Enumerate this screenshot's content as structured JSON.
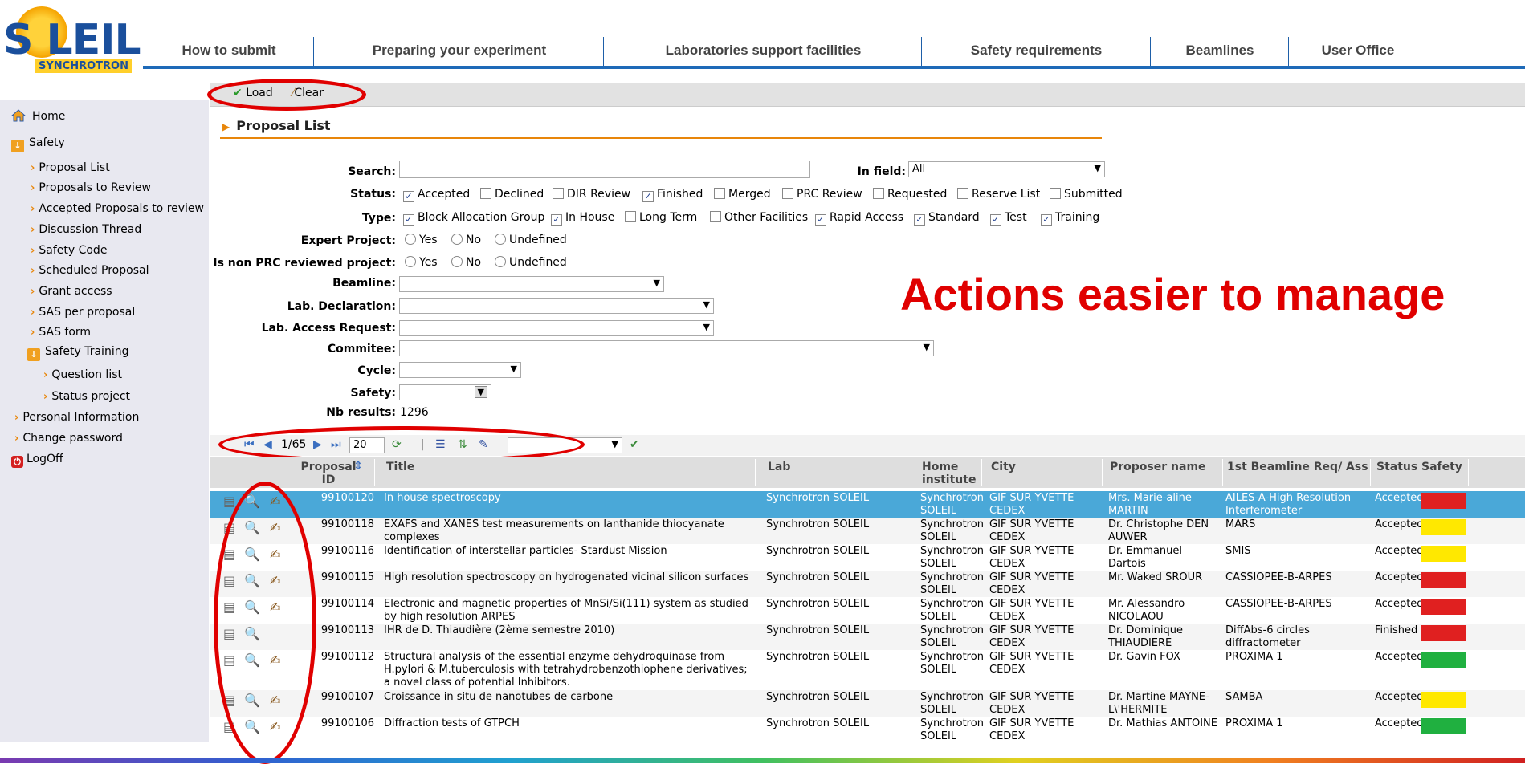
{
  "logo": {
    "word": "S LEIL",
    "sub": "SYNCHROTRON"
  },
  "nav": [
    "How to submit",
    "Preparing your experiment",
    "Laboratories support facilities",
    "Safety requirements",
    "Beamlines",
    "User Office"
  ],
  "sidebar": {
    "home": "Home",
    "safety": "Safety",
    "items": [
      "Proposal List",
      "Proposals to Review",
      "Accepted Proposals to review",
      "Discussion Thread",
      "Safety Code",
      "Scheduled Proposal",
      "Grant access",
      "SAS per proposal",
      "SAS form"
    ],
    "training": "Safety Training",
    "training_items": [
      "Question list",
      "Status project"
    ],
    "personal": "Personal Information",
    "password": "Change password",
    "logoff": "LogOff"
  },
  "toolbar": {
    "load": "Load",
    "clear": "Clear"
  },
  "panel_title": "Proposal List",
  "form": {
    "search_label": "Search:",
    "infield_label": "In field:",
    "infield_value": "All",
    "status_label": "Status:",
    "status_options": [
      {
        "label": "Accepted",
        "checked": true
      },
      {
        "label": "Declined",
        "checked": false
      },
      {
        "label": "DIR Review",
        "checked": false
      },
      {
        "label": "Finished",
        "checked": true
      },
      {
        "label": "Merged",
        "checked": false
      },
      {
        "label": "PRC Review",
        "checked": false
      },
      {
        "label": "Requested",
        "checked": false
      },
      {
        "label": "Reserve List",
        "checked": false
      },
      {
        "label": "Submitted",
        "checked": false
      }
    ],
    "type_label": "Type:",
    "type_options": [
      {
        "label": "Block Allocation Group",
        "checked": true
      },
      {
        "label": "In House",
        "checked": true
      },
      {
        "label": "Long Term",
        "checked": false
      },
      {
        "label": "Other Facilities",
        "checked": false
      },
      {
        "label": "Rapid Access",
        "checked": true
      },
      {
        "label": "Standard",
        "checked": true
      },
      {
        "label": "Test",
        "checked": true
      },
      {
        "label": "Training",
        "checked": true
      }
    ],
    "expert_label": "Expert Project:",
    "nonprc_label": "Is non PRC reviewed project:",
    "radio_options": [
      "Yes",
      "No",
      "Undefined"
    ],
    "beamline_label": "Beamline:",
    "labdecl_label": "Lab. Declaration:",
    "labaccess_label": "Lab. Access Request:",
    "commitee_label": "Commitee:",
    "cycle_label": "Cycle:",
    "safety_label": "Safety:",
    "nbresults_label": "Nb results:",
    "nbresults_value": "1296"
  },
  "annotation": "Actions easier to manage",
  "pager": {
    "page": "1/65",
    "page_size": "20"
  },
  "table": {
    "headers": {
      "proposal_id": "Proposal ID",
      "title": "Title",
      "lab": "Lab",
      "home_institute": "Home institute",
      "city": "City",
      "proposer": "Proposer name",
      "beamline": "1st Beamline Req/ Ass",
      "status": "Status",
      "safety": "Safety"
    },
    "rows": [
      {
        "id": "99100120",
        "title": "In house spectroscopy",
        "lab": "Synchrotron SOLEIL",
        "home": "Synchrotron SOLEIL",
        "city": "GIF SUR YVETTE CEDEX",
        "proposer": "Mrs. Marie-aline MARTIN",
        "beamline": "AILES-A-High Resolution Interferometer",
        "status": "Accepted",
        "safety_color": "#e02020",
        "third_icon": true,
        "selected": true
      },
      {
        "id": "99100118",
        "title": "EXAFS and XANES test measurements on lanthanide thiocyanate complexes",
        "lab": "Synchrotron SOLEIL",
        "home": "Synchrotron SOLEIL",
        "city": "GIF SUR YVETTE CEDEX",
        "proposer": "Dr. Christophe DEN AUWER",
        "beamline": "MARS",
        "status": "Accepted",
        "safety_color": "#ffe800",
        "third_icon": true,
        "selected": false
      },
      {
        "id": "99100116",
        "title": "Identification of interstellar particles- Stardust Mission",
        "lab": "Synchrotron SOLEIL",
        "home": "Synchrotron SOLEIL",
        "city": "GIF SUR YVETTE CEDEX",
        "proposer": "Dr. Emmanuel Dartois",
        "beamline": "SMIS",
        "status": "Accepted",
        "safety_color": "#ffe800",
        "third_icon": true,
        "selected": false
      },
      {
        "id": "99100115",
        "title": "High resolution spectroscopy on hydrogenated vicinal silicon surfaces",
        "lab": "Synchrotron SOLEIL",
        "home": "Synchrotron SOLEIL",
        "city": "GIF SUR YVETTE CEDEX",
        "proposer": "Mr. Waked SROUR",
        "beamline": "CASSIOPEE-B-ARPES",
        "status": "Accepted",
        "safety_color": "#e02020",
        "third_icon": true,
        "selected": false
      },
      {
        "id": "99100114",
        "title": "Electronic and magnetic properties of MnSi/Si(111) system as studied by high resolution ARPES",
        "lab": "Synchrotron SOLEIL",
        "home": "Synchrotron SOLEIL",
        "city": "GIF SUR YVETTE CEDEX",
        "proposer": "Mr. Alessandro NICOLAOU",
        "beamline": "CASSIOPEE-B-ARPES",
        "status": "Accepted",
        "safety_color": "#e02020",
        "third_icon": true,
        "selected": false
      },
      {
        "id": "99100113",
        "title": "IHR de D. Thiaudière (2ème semestre 2010)",
        "lab": "Synchrotron SOLEIL",
        "home": "Synchrotron SOLEIL",
        "city": "GIF SUR YVETTE CEDEX",
        "proposer": "Dr. Dominique THIAUDIERE",
        "beamline": "DiffAbs-6 circles diffractometer",
        "status": "Finished",
        "safety_color": "#e02020",
        "third_icon": false,
        "selected": false
      },
      {
        "id": "99100112",
        "title": "Structural analysis of the essential enzyme dehydroquinase from H.pylori & M.tuberculosis with tetrahydrobenzothiophene derivatives; a novel class of potential Inhibitors.",
        "lab": "Synchrotron SOLEIL",
        "home": "Synchrotron SOLEIL",
        "city": "GIF SUR YVETTE CEDEX",
        "proposer": "Dr. Gavin FOX",
        "beamline": "PROXIMA 1",
        "status": "Accepted",
        "safety_color": "#20b040",
        "third_icon": true,
        "selected": false
      },
      {
        "id": "99100107",
        "title": "Croissance in situ de nanotubes de carbone",
        "lab": "Synchrotron SOLEIL",
        "home": "Synchrotron SOLEIL",
        "city": "GIF SUR YVETTE CEDEX",
        "proposer": "Dr. Martine MAYNE-L\\'HERMITE",
        "beamline": "SAMBA",
        "status": "Accepted",
        "safety_color": "#ffe800",
        "third_icon": true,
        "selected": false
      },
      {
        "id": "99100106",
        "title": "Diffraction tests of GTPCH",
        "lab": "Synchrotron SOLEIL",
        "home": "Synchrotron SOLEIL",
        "city": "GIF SUR YVETTE CEDEX",
        "proposer": "Dr. Mathias ANTOINE",
        "beamline": "PROXIMA 1",
        "status": "Accepted",
        "safety_color": "#20b040",
        "third_icon": true,
        "selected": false
      }
    ]
  }
}
